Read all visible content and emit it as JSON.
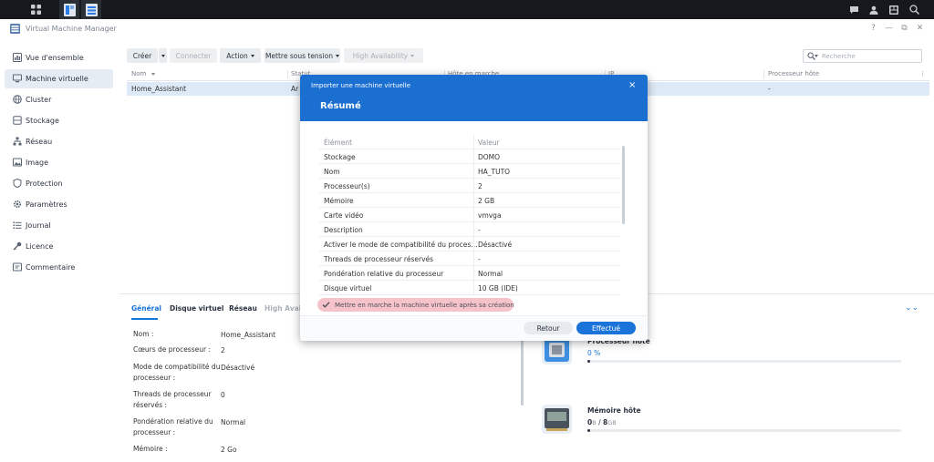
{
  "app": {
    "title": "Virtual Machine Manager"
  },
  "sidebar": {
    "items": [
      {
        "label": "Vue d'ensemble",
        "icon": "overview-icon"
      },
      {
        "label": "Machine virtuelle",
        "icon": "computer-icon",
        "active": true
      },
      {
        "label": "Cluster",
        "icon": "globe-icon"
      },
      {
        "label": "Stockage",
        "icon": "database-icon"
      },
      {
        "label": "Réseau",
        "icon": "network-icon"
      },
      {
        "label": "Image",
        "icon": "image-icon"
      },
      {
        "label": "Protection",
        "icon": "shield-icon"
      },
      {
        "label": "Paramètres",
        "icon": "gear-icon"
      },
      {
        "label": "Journal",
        "icon": "list-icon"
      },
      {
        "label": "Licence",
        "icon": "key-icon"
      },
      {
        "label": "Commentaire",
        "icon": "comment-icon"
      }
    ]
  },
  "toolbar": {
    "create": "Créer",
    "connect": "Connecter",
    "action": "Action",
    "power_on": "Mettre sous tension",
    "ha": "High Availability",
    "search_placeholder": "Recherche"
  },
  "table": {
    "headers": [
      "Nom",
      "Statut",
      "Hôte en marche",
      "IP",
      "Processeur hôte"
    ],
    "rows": [
      {
        "name": "Home_Assistant",
        "status": "Ar",
        "cpu": "-"
      }
    ]
  },
  "detail": {
    "tabs": [
      "Général",
      "Disque virtuel",
      "Réseau",
      "High Availa"
    ],
    "fields": [
      {
        "label": "Nom :",
        "value": "Home_Assistant"
      },
      {
        "label": "Cœurs de processeur :",
        "value": "2"
      },
      {
        "label": "Mode de compatibilité du processeur :",
        "value": "Désactivé"
      },
      {
        "label": "Threads de processeur réservés :",
        "value": "0"
      },
      {
        "label": "Pondération relative du processeur :",
        "value": "Normal"
      },
      {
        "label": "Mémoire :",
        "value": "2 Go"
      }
    ],
    "cpu": {
      "title": "Processeur hôte",
      "value": "0 %",
      "fraction": 0.01
    },
    "memory": {
      "title": "Mémoire hôte",
      "used": "0",
      "used_unit": "B",
      "total": "8",
      "total_unit": "GB",
      "separator": "/",
      "fraction": 0.01
    }
  },
  "modal": {
    "title": "Importer une machine virtuelle",
    "subtitle": "Résumé",
    "col_key": "Élément",
    "col_value": "Valeur",
    "rows": [
      {
        "k": "Stockage",
        "v": "DOMO"
      },
      {
        "k": "Nom",
        "v": "HA_TUTO"
      },
      {
        "k": "Processeur(s)",
        "v": "2"
      },
      {
        "k": "Mémoire",
        "v": "2 GB"
      },
      {
        "k": "Carte vidéo",
        "v": "vmvga"
      },
      {
        "k": "Description",
        "v": "-"
      },
      {
        "k": "Activer le mode de compatibilité du proces...",
        "v": "Désactivé"
      },
      {
        "k": "Threads de processeur réservés",
        "v": "-"
      },
      {
        "k": "Pondération relative du processeur",
        "v": "Normal"
      },
      {
        "k": "Disque virtuel",
        "v": "10 GB (IDE)"
      }
    ],
    "checkbox_label": "Mettre en marche la machine virtuelle après sa création",
    "back": "Retour",
    "done": "Effectué"
  },
  "colors": {
    "accent": "#1a73d9",
    "header": "#1a6fd1",
    "highlight": "#f7c3cb",
    "selected_row": "#dde9f6",
    "taskbar": "#16181d"
  }
}
